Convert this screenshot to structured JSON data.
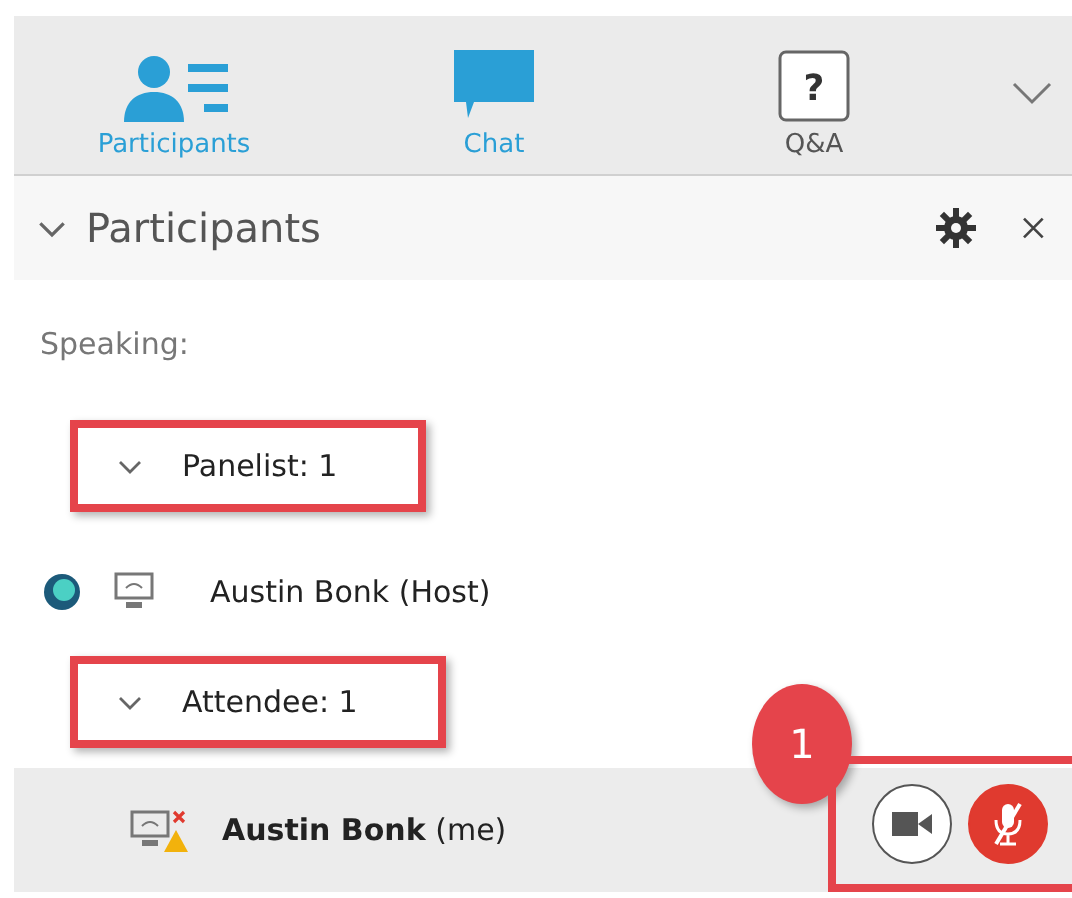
{
  "tabs": [
    {
      "kind": "participants",
      "label": "Participants",
      "color": "#2a9fd6"
    },
    {
      "kind": "chat",
      "label": "Chat",
      "color": "#2a9fd6"
    },
    {
      "kind": "qa",
      "label": "Q&A",
      "color": "#555555",
      "glyph": "?"
    }
  ],
  "panel": {
    "title": "Participants",
    "expanded": true
  },
  "speaking": "Speaking:",
  "groups": [
    {
      "label": "Panelist: 1",
      "expanded": true,
      "highlighted": true,
      "members": [
        {
          "name": "Austin Bonk (Host)",
          "self": false,
          "warning": false,
          "status_dot": true
        }
      ]
    },
    {
      "label": "Attendee: 1",
      "expanded": true,
      "highlighted": true,
      "members": [
        {
          "name": "Austin Bonk",
          "suffix": "(me)",
          "self": true,
          "warning": true,
          "status_dot": false,
          "video_on": false,
          "muted": true
        }
      ]
    }
  ],
  "callout": {
    "badge": "1"
  }
}
